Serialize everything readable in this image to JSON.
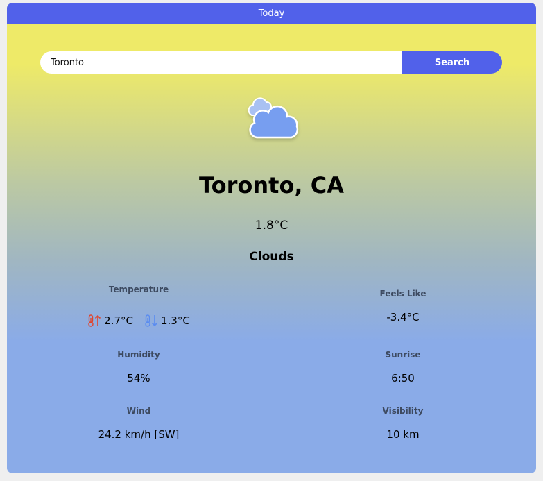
{
  "tab": {
    "label": "Today"
  },
  "search": {
    "value": "Toronto",
    "button_label": "Search"
  },
  "weather": {
    "icon": "clouds-icon",
    "city": "Toronto, CA",
    "temperature": "1.8°C",
    "condition": "Clouds"
  },
  "stats": {
    "temperature": {
      "label": "Temperature",
      "high": "2.7°C",
      "low": "1.3°C"
    },
    "feels_like": {
      "label": "Feels Like",
      "value": "-3.4°C"
    },
    "humidity": {
      "label": "Humidity",
      "value": "54%"
    },
    "sunrise": {
      "label": "Sunrise",
      "value": "6:50"
    },
    "wind": {
      "label": "Wind",
      "value": "24.2 km/h [SW]"
    },
    "visibility": {
      "label": "Visibility",
      "value": "10 km"
    }
  },
  "colors": {
    "accent": "#5161ea",
    "high_temp": "#e0442c",
    "low_temp": "#5a8cf0"
  }
}
